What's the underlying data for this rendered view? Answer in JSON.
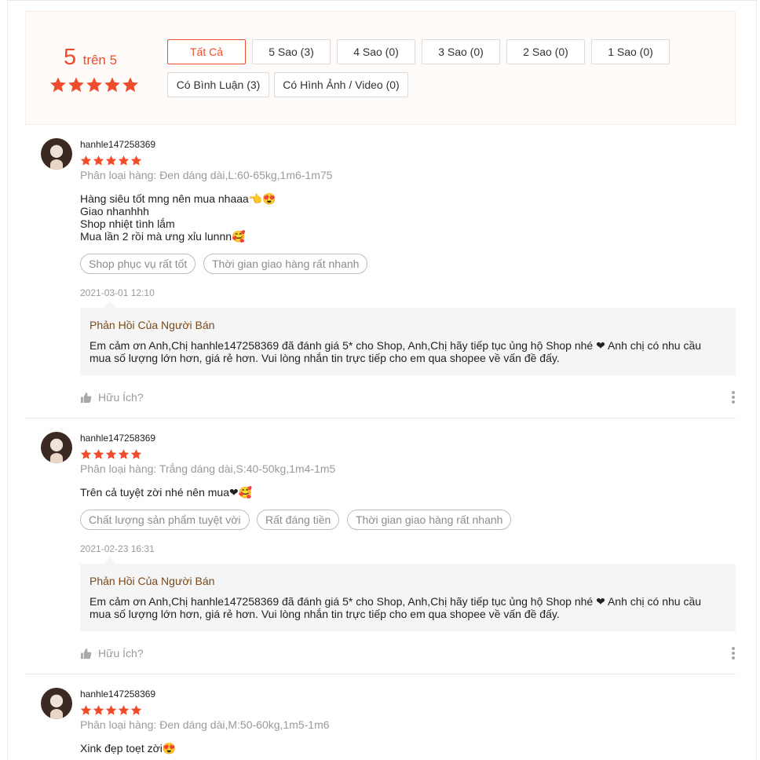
{
  "overview": {
    "score": "5",
    "score_suffix": "trên 5",
    "rating": 5,
    "filters": [
      {
        "label": "Tất Cả",
        "active": true
      },
      {
        "label": "5 Sao (3)",
        "active": false
      },
      {
        "label": "4 Sao (0)",
        "active": false
      },
      {
        "label": "3 Sao (0)",
        "active": false
      },
      {
        "label": "2 Sao (0)",
        "active": false
      },
      {
        "label": "1 Sao (0)",
        "active": false
      },
      {
        "label": "Có Bình Luận (3)",
        "active": false
      },
      {
        "label": "Có Hình Ảnh / Video (0)",
        "active": false
      }
    ]
  },
  "reviews": [
    {
      "username": "hanhle147258369",
      "rating": 5,
      "variant": "Phân loại hàng: Đen dáng dài,L:60-65kg,1m6-1m75",
      "comment": "Hàng siêu tốt mng nên mua nhaaa👈😍\nGiao nhanhhh\nShop nhiệt tình lắm\nMua lần 2 rồi mà ưng xỉu lunnn🥰",
      "tags": [
        "Shop phục vụ rất tốt",
        "Thời gian giao hàng rất nhanh"
      ],
      "date": "2021-03-01 12:10",
      "reply_title": "Phản Hồi Của Người Bán",
      "reply_text": "Em cảm ơn Anh,Chị hanhle147258369 đã đánh giá 5* cho Shop, Anh,Chị hãy tiếp tục ủng hộ Shop nhé ❤ Anh chị có nhu cầu mua số lượng lớn hơn, giá rẻ hơn. Vui lòng nhắn tin trực tiếp cho em qua shopee về vấn đề đấy.",
      "helpful_label": "Hữu Ích?"
    },
    {
      "username": "hanhle147258369",
      "rating": 5,
      "variant": "Phân loại hàng: Trắng dáng dài,S:40-50kg,1m4-1m5",
      "comment": "Trên cả tuyệt zời nhé nên mua❤🥰",
      "tags": [
        "Chất lượng sản phẩm tuyệt vời",
        "Rất đáng tiền",
        "Thời gian giao hàng rất nhanh"
      ],
      "date": "2021-02-23 16:31",
      "reply_title": "Phản Hồi Của Người Bán",
      "reply_text": "Em cảm ơn Anh,Chị hanhle147258369 đã đánh giá 5* cho Shop, Anh,Chị hãy tiếp tục ủng hộ Shop nhé ❤ Anh chị có nhu cầu mua số lượng lớn hơn, giá rẻ hơn. Vui lòng nhắn tin trực tiếp cho em qua shopee về vấn đề đấy.",
      "helpful_label": "Hữu Ích?"
    },
    {
      "username": "hanhle147258369",
      "rating": 5,
      "variant": "Phân loại hàng: Đen dáng dài,M:50-60kg,1m5-1m6",
      "comment": "Xink đẹp toẹt zời😍"
    }
  ],
  "colors": {
    "accent": "#ee4d2d",
    "reply_title": "#7a4a1a"
  }
}
